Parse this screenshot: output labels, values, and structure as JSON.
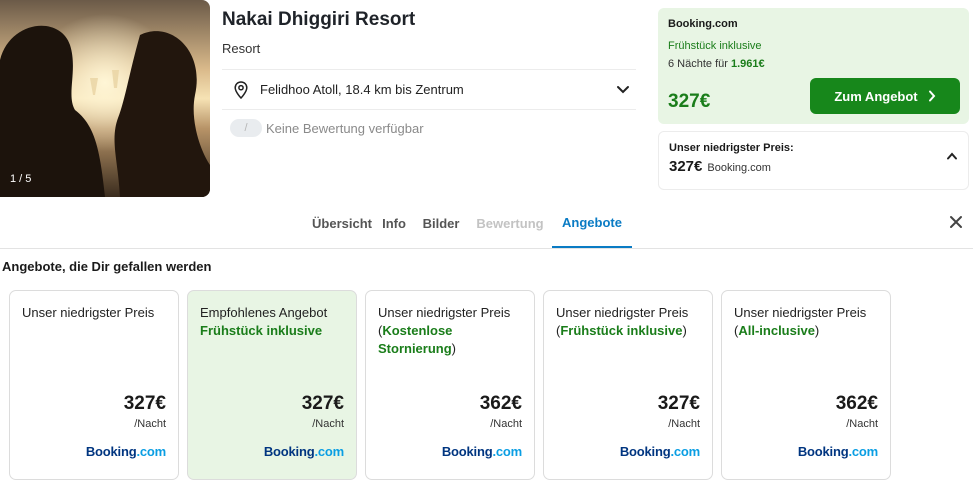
{
  "hotel": {
    "name": "Nakai Dhiggiri Resort",
    "type": "Resort",
    "location": "Felidhoo Atoll, 18.4 km bis Zentrum",
    "rating_badge": "/",
    "rating_text": "Keine Bewertung verfügbar",
    "photo_counter": "1 / 5"
  },
  "deal": {
    "provider": "Booking.com",
    "breakfast": "Frühstück inklusive",
    "nights_prefix": "6 Nächte für ",
    "nights_total": "1.961€",
    "price": "327€",
    "button": "Zum Angebot"
  },
  "lowest": {
    "label": "Unser niedrigster Preis:",
    "price": "327€",
    "provider": "Booking.com"
  },
  "tabs": [
    {
      "label": "Übersicht",
      "state": "normal"
    },
    {
      "label": "Info",
      "state": "normal"
    },
    {
      "label": "Bilder",
      "state": "normal"
    },
    {
      "label": "Bewertung",
      "state": "disabled"
    },
    {
      "label": "Angebote",
      "state": "active"
    }
  ],
  "offers_heading": "Angebote, die Dir gefallen werden",
  "offers": [
    {
      "title": "Unser niedrigster Preis",
      "subtitle": "",
      "price": "327€",
      "unit": "/Nacht",
      "logo_a": "Booking",
      "logo_b": ".com"
    },
    {
      "title": "Empfohlenes Angebot",
      "subtitle": "Frühstück inklusive",
      "price": "327€",
      "unit": "/Nacht",
      "logo_a": "Booking",
      "logo_b": ".com"
    },
    {
      "title": "Unser niedrigster Preis",
      "subtitle": "Kostenlose Stornierung",
      "price": "362€",
      "unit": "/Nacht",
      "logo_a": "Booking",
      "logo_b": ".com"
    },
    {
      "title": "Unser niedrigster Preis",
      "subtitle": "Frühstück inklusive",
      "price": "327€",
      "unit": "/Nacht",
      "logo_a": "Booking",
      "logo_b": ".com"
    },
    {
      "title": "Unser niedrigster Preis",
      "subtitle": "All-inclusive",
      "price": "362€",
      "unit": "/Nacht",
      "logo_a": "Booking",
      "logo_b": ".com"
    }
  ],
  "icons": {
    "location": "map-pin-icon",
    "expand": "chevron-down-icon",
    "button": "chevron-right-icon",
    "collapse": "chevron-up-icon",
    "close": "close-icon"
  },
  "colors": {
    "accent_green": "#17871b",
    "price_green": "#1a7d1a",
    "deal_bg": "#e8f5e4",
    "tab_active": "#0a7bc4",
    "booking_blue": "#003580"
  }
}
